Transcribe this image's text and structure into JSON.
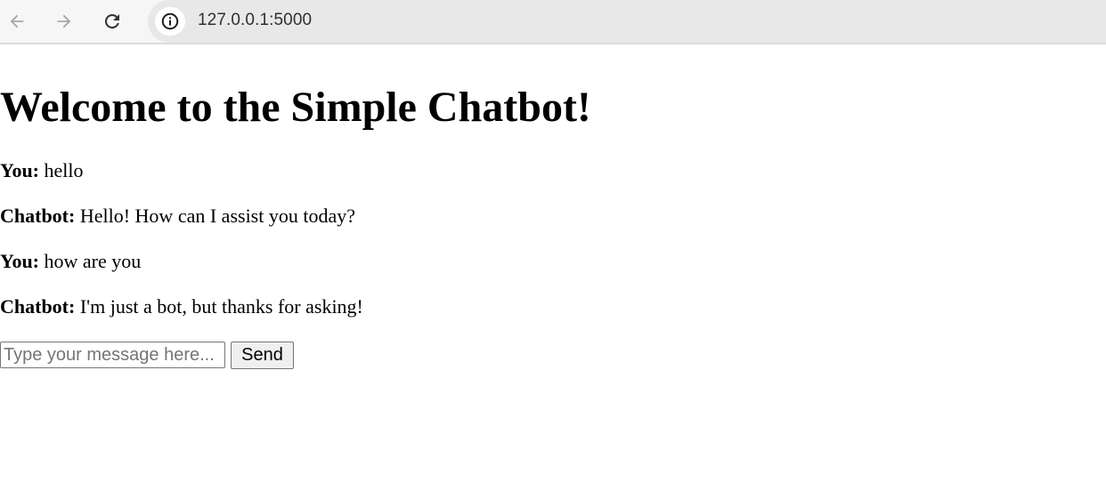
{
  "browser": {
    "url": "127.0.0.1:5000",
    "icons": {
      "back": "arrow-left-icon",
      "forward": "arrow-right-icon",
      "reload": "reload-icon",
      "site_info": "info-icon"
    }
  },
  "page": {
    "title": "Welcome to the Simple Chatbot!",
    "messages": [
      {
        "speaker": "You:",
        "text": " hello"
      },
      {
        "speaker": "Chatbot:",
        "text": " Hello! How can I assist you today?"
      },
      {
        "speaker": "You:",
        "text": " how are you"
      },
      {
        "speaker": "Chatbot:",
        "text": " I'm just a bot, but thanks for asking!"
      }
    ],
    "form": {
      "input_value": "",
      "input_placeholder": "Type your message here...",
      "send_label": "Send"
    }
  }
}
